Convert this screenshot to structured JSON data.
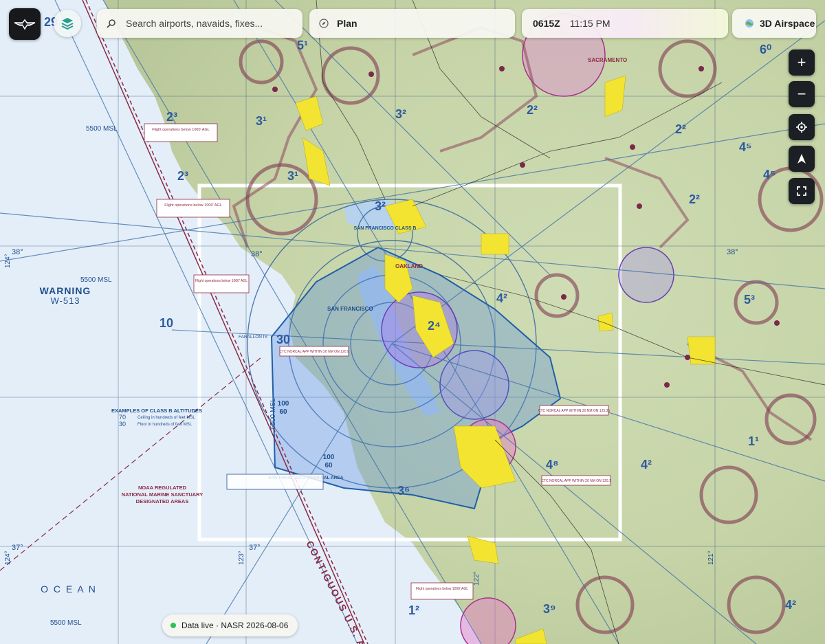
{
  "toolbar": {
    "search_placeholder": "Search airports, navaids, fixes...",
    "plan_label": "Plan",
    "zulu_time": "0615Z",
    "local_time": "11:15 PM",
    "airspace_3d_label": "3D Airspace"
  },
  "map_controls": {
    "icons": [
      "zoom-in-icon",
      "zoom-out-icon",
      "locate-icon",
      "north-up-icon",
      "fullscreen-icon"
    ],
    "zoom_in_glyph": "+",
    "zoom_out_glyph": "−"
  },
  "status": {
    "text": "Data live · NASR 2026-08-06",
    "color": "#2fbf5a"
  },
  "chart": {
    "warning_area": "WARNING",
    "warning_id": "W-513",
    "msl_1": "5500 MSL",
    "msl_2": "5500 MSL",
    "msl_3": "5500 MSL",
    "msl_4": "5500 MSL",
    "ocean": "O C E A N",
    "contiguous": "CONTIGUOUS U.S. AD",
    "class_b": "SAN FRANCISCO CLASS B",
    "examples_title": "EXAMPLES OF CLASS B ALTITUDES",
    "examples_ceiling": "Ceiling in hundreds of feet MSL",
    "examples_floor": "Floor in hundreds of feet MSL",
    "examples_70": "70",
    "examples_30": "30",
    "sanctuary_1": "NOAA REGULATED",
    "sanctuary_2": "NATIONAL MARINE SANCTUARY",
    "sanctuary_3": "DESIGNATED AREAS",
    "lat_38": "38°",
    "lat_37": "37°",
    "lon_124a": "124°",
    "lon_124b": "124°",
    "lon_123": "123°",
    "lon_122": "122°",
    "lon_121": "121°",
    "sfo_terminal": "SAN FRANCISCO TERMINAL AREA",
    "farallon": "FARALLON IS",
    "grid_100_60_a": "100",
    "grid_60_a": "60",
    "grid_100_60_b": "100",
    "grid_60_b": "60",
    "num_30": "30",
    "num_10": "10",
    "num_23a": "2³",
    "num_23b": "2³",
    "num_51": "5¹",
    "num_31a": "3¹",
    "num_31b": "3¹",
    "num_32a": "3²",
    "num_32b": "3²",
    "num_22a": "2²",
    "num_22b": "2²",
    "num_22c": "2²",
    "num_45a": "4⁵",
    "num_45b": "4⁵",
    "num_60": "6⁰",
    "num_42a": "4²",
    "num_42b": "4²",
    "num_42c": "4²",
    "num_48": "4⁸",
    "num_36": "3⁶",
    "num_39": "3⁹",
    "num_11": "1¹",
    "num_12": "1²",
    "num_53": "5³",
    "num_24": "2⁴",
    "num_29": "29",
    "sfo_label": "SAN FRANCISCO",
    "oakland_label": "OAKLAND",
    "sacramento_label": "SACRAMENTO",
    "ctc_1": "CTC NORCAL APP WITHIN 20 NM ON 120.9",
    "ctc_2": "CTC NORCAL APP WITHIN 20 NM ON 125.35",
    "ctc_3": "CTC NORCAL APP WITHIN 20 NM ON 120.1",
    "flight_ops": "Flight operations below 1000' AGL"
  }
}
